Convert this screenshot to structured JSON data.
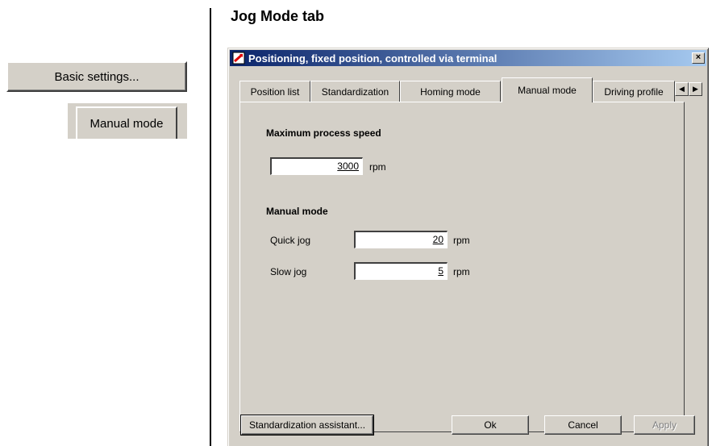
{
  "sidebar": {
    "basic_settings_label": "Basic settings...",
    "manual_mode_label": "Manual mode"
  },
  "heading": "Jog Mode tab",
  "dialog": {
    "title": "Positioning, fixed position, controlled via terminal",
    "close_glyph": "×",
    "tabs": [
      {
        "label": "Position list",
        "active": false
      },
      {
        "label": "Standardization",
        "active": false
      },
      {
        "label": "Homing mode",
        "active": false
      },
      {
        "label": "Manual mode",
        "active": true
      },
      {
        "label": "Driving profile",
        "active": false
      }
    ],
    "tab_scroll_left": "◀",
    "tab_scroll_right": "▶",
    "max_speed": {
      "section_title": "Maximum process speed",
      "value": "3000",
      "unit": "rpm"
    },
    "manual_mode": {
      "section_title": "Manual mode",
      "quick_jog_label": "Quick jog",
      "quick_jog_value": "20",
      "quick_jog_unit": "rpm",
      "slow_jog_label": "Slow jog",
      "slow_jog_value": "5",
      "slow_jog_unit": "rpm"
    },
    "buttons": {
      "assistant": "Standardization assistant...",
      "ok": "Ok",
      "cancel": "Cancel",
      "apply": "Apply"
    }
  },
  "colors": {
    "window_bg": "#d4d0c8",
    "title_gradient_start": "#0a246a",
    "title_gradient_end": "#a6caf0"
  }
}
